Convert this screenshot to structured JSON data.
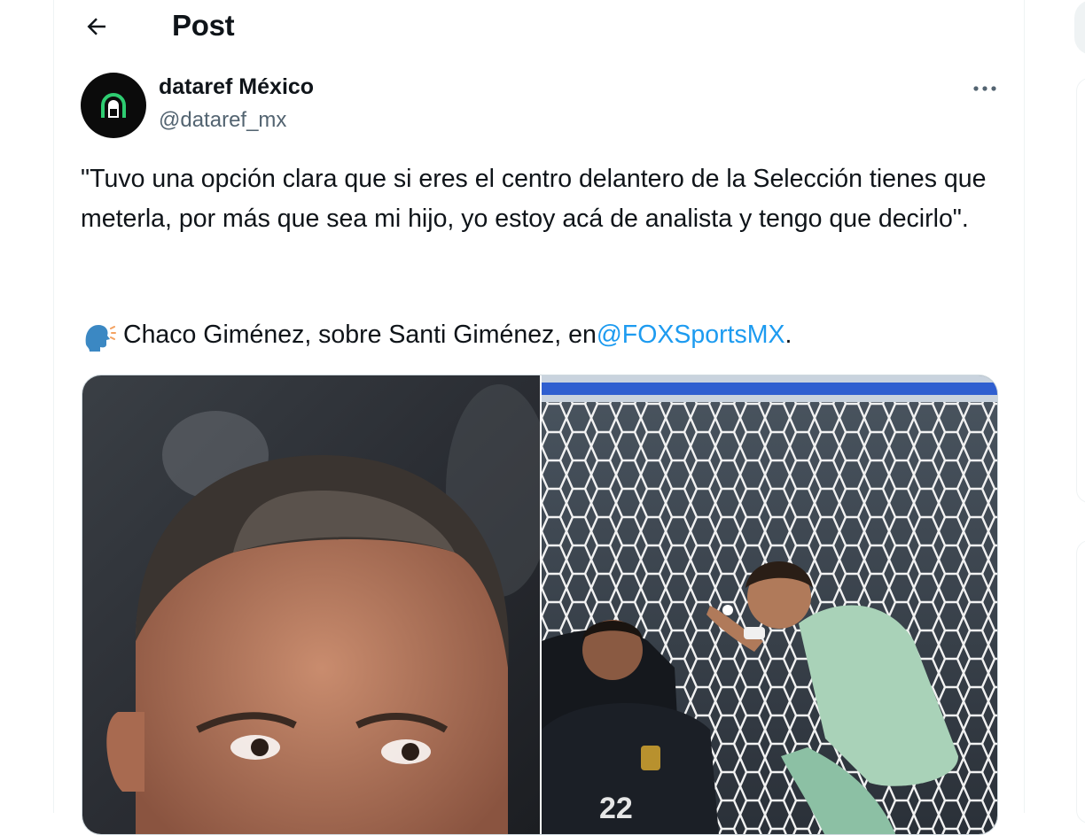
{
  "header": {
    "title": "Post"
  },
  "post": {
    "author_name": "dataref México",
    "author_handle": "@dataref_mx",
    "text_quote": "\"Tuvo una opción clara que si eres el centro delantero de la Selección tienes que meterla, por más que sea mi hijo, yo estoy acá de analista y tengo que decirlo\".",
    "attribution_prefix": "Chaco Giménez, sobre Santi Giménez, en ",
    "attribution_mention": "@FOXSportsMX",
    "attribution_suffix": "."
  },
  "media": {
    "right_goalkeeper_number": "22"
  },
  "colors": {
    "accent": "#1d9bf0",
    "text": "#0f1419",
    "secondary": "#536471",
    "border": "#eff3f4",
    "logo_green": "#2ecc71"
  },
  "icons": {
    "back": "arrow-left-icon",
    "more": "more-horizontal-icon",
    "speaker": "speaking-head-icon"
  }
}
